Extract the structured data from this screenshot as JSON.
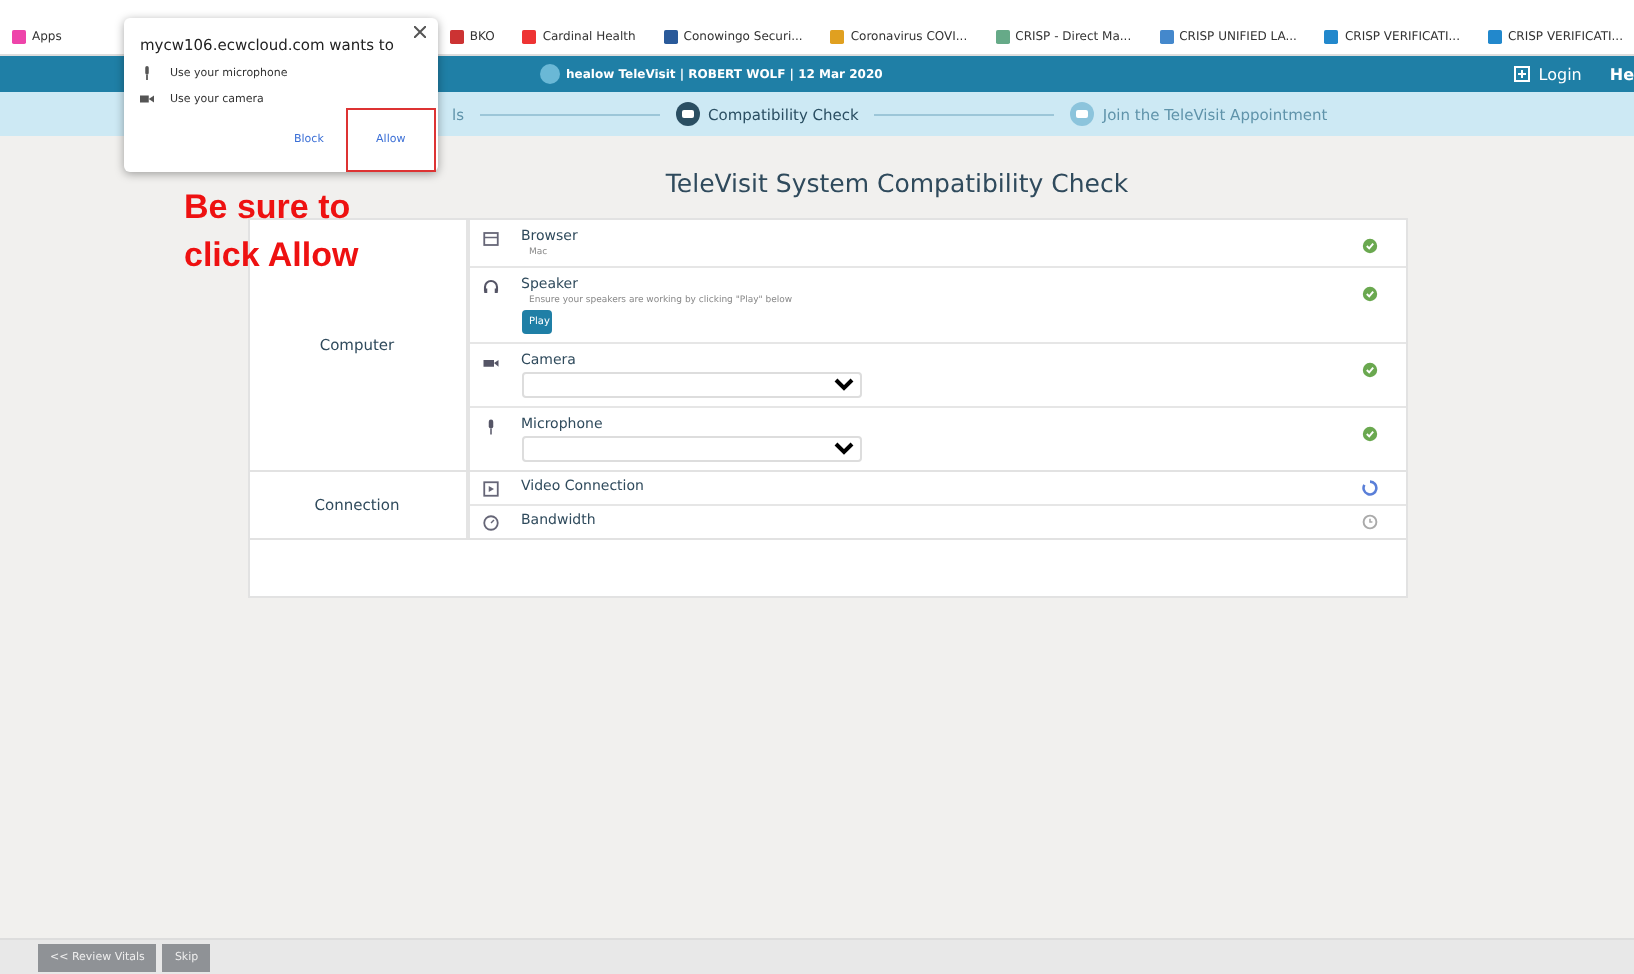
{
  "bookmarks": [
    "Apps",
    "BKO",
    "Cardinal Health",
    "Conowingo Securi...",
    "Coronavirus COVI...",
    "CRISP - Direct Ma...",
    "CRISP UNIFIED LA...",
    "CRISP VERIFICATI...",
    "CRISP VERIFICATI..."
  ],
  "header": {
    "title": "healow TeleVisit | ROBERT WOLF | 12 Mar 2020",
    "login": "Login",
    "cut_item": "He"
  },
  "steps": [
    {
      "label": "ls",
      "selected": false
    },
    {
      "label": "Compatibility Check",
      "selected": true
    },
    {
      "label": "Join the TeleVisit Appointment",
      "selected": false
    }
  ],
  "page_title": "TeleVisit System Compatibility Check",
  "groups": [
    {
      "name": "Computer",
      "items": [
        {
          "kind": "info",
          "label": "Browser",
          "detail": "Mac",
          "status": {
            "kind": "passed"
          }
        },
        {
          "kind": "play",
          "label": "Speaker",
          "detail": "Ensure your speakers are working by clicking \"Play\" below",
          "button": "Play",
          "status": {
            "kind": "passed"
          }
        },
        {
          "kind": "select",
          "label": "Camera",
          "status": {
            "kind": "passed"
          }
        },
        {
          "kind": "select",
          "label": "Microphone",
          "status": {
            "kind": "passed"
          }
        }
      ]
    },
    {
      "name": "Connection",
      "items": [
        {
          "kind": "plain",
          "label": "Video Connection",
          "status": {
            "kind": "checking"
          }
        },
        {
          "kind": "plain",
          "label": "Bandwidth",
          "status": {
            "kind": "pending"
          }
        }
      ]
    }
  ],
  "footer_buttons": [
    "<< Review Vitals",
    "Skip"
  ],
  "permission_popup": {
    "title": "mycw106.ecwcloud.com wants to",
    "permissions": [
      "Use your microphone",
      "Use your camera"
    ],
    "buttons": [
      {
        "label": "Block",
        "highlighted": false
      },
      {
        "label": "Allow",
        "highlighted": true
      }
    ]
  },
  "annotation": "Be sure to click Allow"
}
